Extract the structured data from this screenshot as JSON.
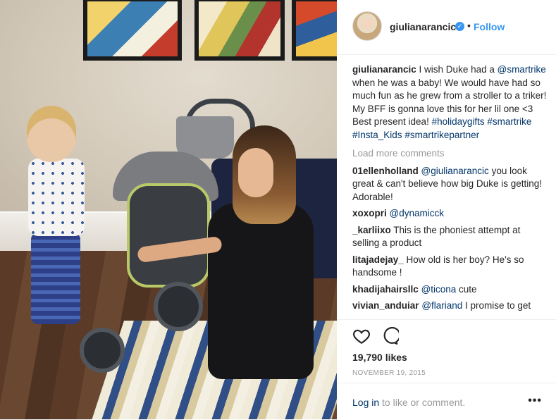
{
  "post": {
    "username": "giulianarancic",
    "follow_label": "Follow",
    "separator": "•",
    "verified_symbol": "✓"
  },
  "caption": {
    "username": "giulianarancic",
    "t1": " I wish Duke had a ",
    "mention": "@smartrike",
    "t2": " when he was a baby! We would have had so much fun as he grew from a stroller to a triker! My BFF is gonna love this for her lil one <3 Best present idea! ",
    "tag1": "#holidaygifts",
    "tag2": "#smartrike",
    "tag3": "#Insta_Kids",
    "tag4": "#smartrikepartner"
  },
  "load_more": "Load more comments",
  "comments": [
    {
      "user": "01ellenholland",
      "mention": "@giulianarancic",
      "text": " you look great & can't believe how big Duke is getting! Adorable!"
    },
    {
      "user": "xoxopri",
      "mention": "@dynamicck",
      "text": ""
    },
    {
      "user": "_karliixo",
      "mention": "",
      "text": " This is the phoniest attempt at selling a product"
    },
    {
      "user": "litajadejay_",
      "mention": "",
      "text": " How old is her boy? He's so handsome !"
    },
    {
      "user": "khadijahairsllc",
      "mention": "@ticona",
      "text": " cute"
    },
    {
      "user": "vivian_anduiar",
      "mention": "@flariand",
      "text": " I promise to get"
    }
  ],
  "likes_count": "19,790 likes",
  "date": "NOVEMBER 19, 2015",
  "footer": {
    "login_link": "Log in",
    "login_rest": " to like or comment.",
    "more_symbol": "•••"
  },
  "icons": {
    "like": "heart-icon",
    "comment": "comment-bubble-icon",
    "more": "more-options-icon",
    "verified": "verified-badge-icon"
  },
  "colors": {
    "accent": "#3897f0",
    "link": "#003569",
    "muted": "#999999",
    "text": "#262626",
    "border": "#efefef"
  }
}
